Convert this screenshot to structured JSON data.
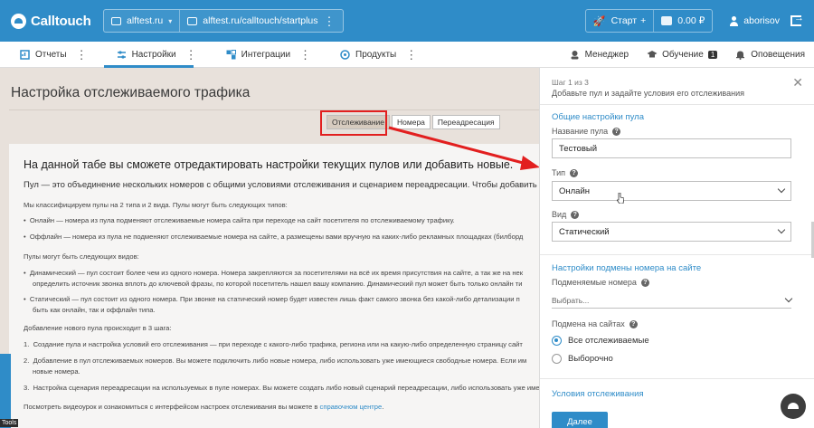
{
  "app": {
    "logo_text": "Calltouch"
  },
  "topbar": {
    "project": "alftest.ru",
    "site": "alftest.ru/calltouch/startplus",
    "start_label": "Старт",
    "start_plus": "+",
    "balance": "0.00 ₽",
    "username": "aborisov"
  },
  "nav": {
    "items": [
      {
        "label": "Отчеты",
        "icon": "reports-icon",
        "active": false
      },
      {
        "label": "Настройки",
        "icon": "settings-icon",
        "active": true
      },
      {
        "label": "Интеграции",
        "icon": "integrations-icon",
        "active": false
      },
      {
        "label": "Продукты",
        "icon": "products-icon",
        "active": false
      }
    ],
    "right": [
      {
        "label": "Менеджер",
        "icon": "manager-icon"
      },
      {
        "label": "Обучение",
        "icon": "education-icon",
        "badge": "1"
      },
      {
        "label": "Оповещения",
        "icon": "bell-icon"
      }
    ]
  },
  "main": {
    "title": "Настройка отслеживаемого трафика",
    "tabs": [
      {
        "label": "Отслеживание",
        "active": true
      },
      {
        "label": "Номера",
        "active": false
      },
      {
        "label": "Переадресация",
        "active": false
      }
    ],
    "content": {
      "heading": "На данной табе вы сможете отредактировать настройки текущих пулов или добавить новые.",
      "lead": "Пул — это объединение нескольких номеров с общими условиями отслеживания и сценарием переадресации. Чтобы добавить новый",
      "types_intro": "Мы классифицируем пулы на 2 типа и 2 вида. Пулы могут быть следующих типов:",
      "types": [
        "Онлайн — номера из пула подменяют отслеживаемые номера сайта при переходе на сайт посетителя по отслеживаемому трафику.",
        "Оффлайн — номера из пула не подменяют отслеживаемые номера на сайте, а размещены вами вручную на каких-либо рекламных площадках (билборд"
      ],
      "kinds_intro": "Пулы могут быть следующих видов:",
      "kinds": [
        "Динамический — пул состоит более чем из одного номера. Номера закрепляются за посетителями на всё их время присутствия на сайте, а так же на нек",
        "определить источник звонка вплоть до ключевой фразы, по которой посетитель нашел вашу компанию. Динамический пул может быть только онлайн ти",
        "Статический — пул состоит из одного номера. При звонке на статический номер будет известен лишь факт самого звонка без какой-либо детализации п",
        "быть как онлайн, так и оффлайн типа."
      ],
      "steps_intro": "Добавление нового пула происходит в 3 шага:",
      "steps": [
        "Создание пула и настройка условий его отслеживания — при переходе с какого-либо трафика, региона или на какую-либо определенную страницу сайт",
        "Добавление в пул отслеживаемых номеров. Вы можете подключить либо новые номера, либо использовать уже имеющиеся свободные номера. Если им",
        "новые номера.",
        "Настройка сценария переадресации на используемых в пуле номерах. Вы можете создать либо новый сценарий переадресации, либо использовать уже имеющ"
      ],
      "footer_text": "Посмотреть видеоурок и ознакомиться с интерфейсом настроек отслеживания вы можете в ",
      "footer_link": "справочном центре",
      "footer_end": "."
    },
    "tools_label": "Tools"
  },
  "panel": {
    "step": "Шаг 1 из 3",
    "subtitle": "Добавьте пул и задайте условия его отслеживания",
    "section_general": "Общие настройки пула",
    "pool_name_label": "Название пула",
    "pool_name_value": "Тестовый",
    "type_label": "Тип",
    "type_value": "Онлайн",
    "kind_label": "Вид",
    "kind_value": "Статический",
    "section_substitution": "Настройки подмены номера на сайте",
    "substituted_label": "Подменяемые номера",
    "substituted_placeholder": "Выбрать...",
    "sites_label": "Подмена на сайтах",
    "radio_all": "Все отслеживаемые",
    "radio_selective": "Выборочно",
    "section_conditions": "Условия отслеживания",
    "next_button": "Далее"
  },
  "colors": {
    "accent": "#2f8cc8",
    "highlight": "#e21f1f"
  }
}
